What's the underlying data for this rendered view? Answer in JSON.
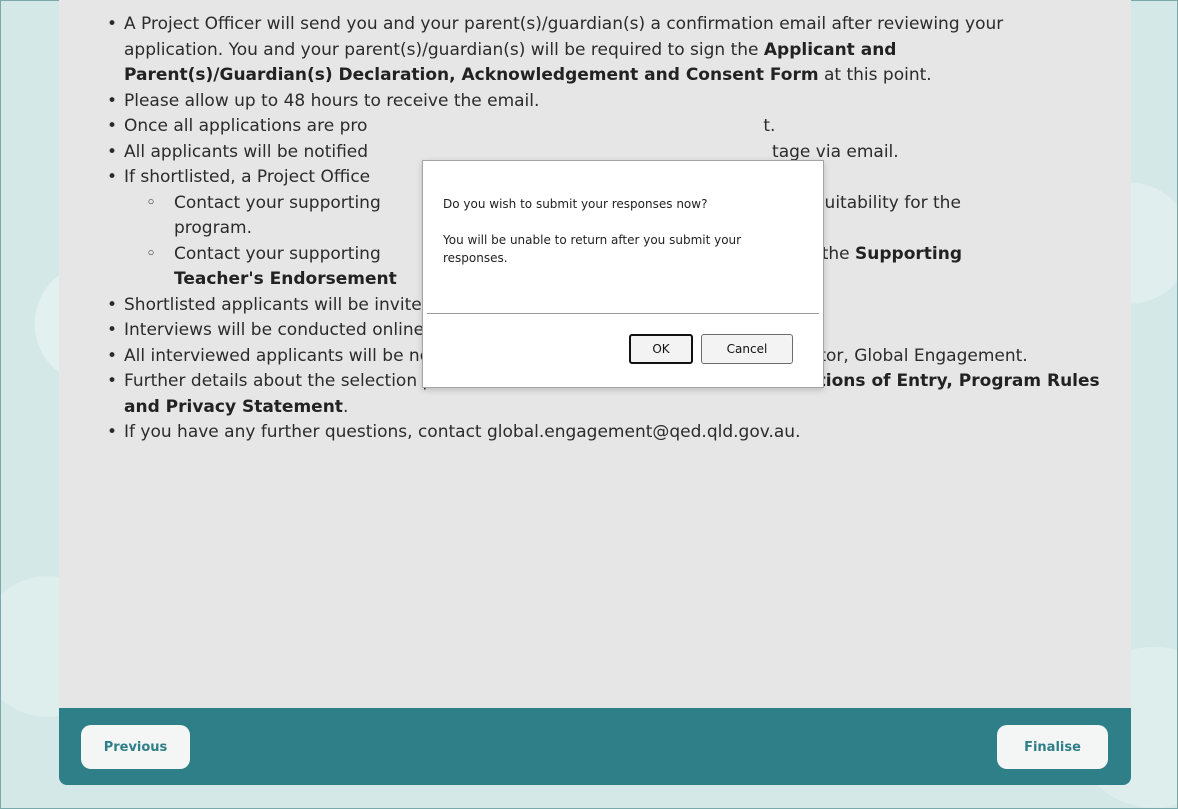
{
  "content": {
    "items": [
      {
        "segments": [
          "A Project Officer will send you and your parent(s)/guardian(s) a confirmation email after reviewing your application. You and your parent(s)/guardian(s) will be required to sign the ",
          "Applicant and Parent(s)/Guardian(s) Declaration, Acknowledgement and Consent Form",
          " at this point."
        ]
      },
      {
        "text": "Please allow up to 48 hours to receive the email."
      },
      {
        "text": "Once all applications are pro",
        "tail": "t."
      },
      {
        "text": "All applicants will be notified",
        "tail": "tage via email."
      },
      {
        "text": "If shortlisted, a Project Office",
        "sub": [
          {
            "head": "Contact your supporting",
            "tail": "nd suitability for the",
            "line2": "program."
          },
          {
            "head": "Contact your supporting",
            "tail": "ete the ",
            "bold_tail": "Supporting",
            "bold_line2": "Teacher's Endorsement"
          }
        ]
      },
      {
        "text": "Shortlisted applicants will be invited to an interview with a selection panel."
      },
      {
        "text": "Interviews will be conducted online via Microsoft Teams."
      },
      {
        "text": "All interviewed applicants will be notified of the outcome via email from the Director, Global Engagement."
      },
      {
        "segments": [
          "Further details about the selection process can be found in the ",
          "Students: Conditions of Entry, Program Rules and Privacy Statement",
          "."
        ]
      },
      {
        "text": "If you have any further questions, contact global.engagement@qed.qld.gov.au."
      }
    ]
  },
  "footer": {
    "previous_label": "Previous",
    "finalise_label": "Finalise"
  },
  "dialog": {
    "question": "Do you wish to submit your responses now?",
    "warning": "You will be unable to return after you submit your responses.",
    "ok_label": "OK",
    "cancel_label": "Cancel"
  },
  "colors": {
    "accent": "#2e7f88",
    "panel": "#e6e6e6",
    "background": "#d3e8e7"
  }
}
